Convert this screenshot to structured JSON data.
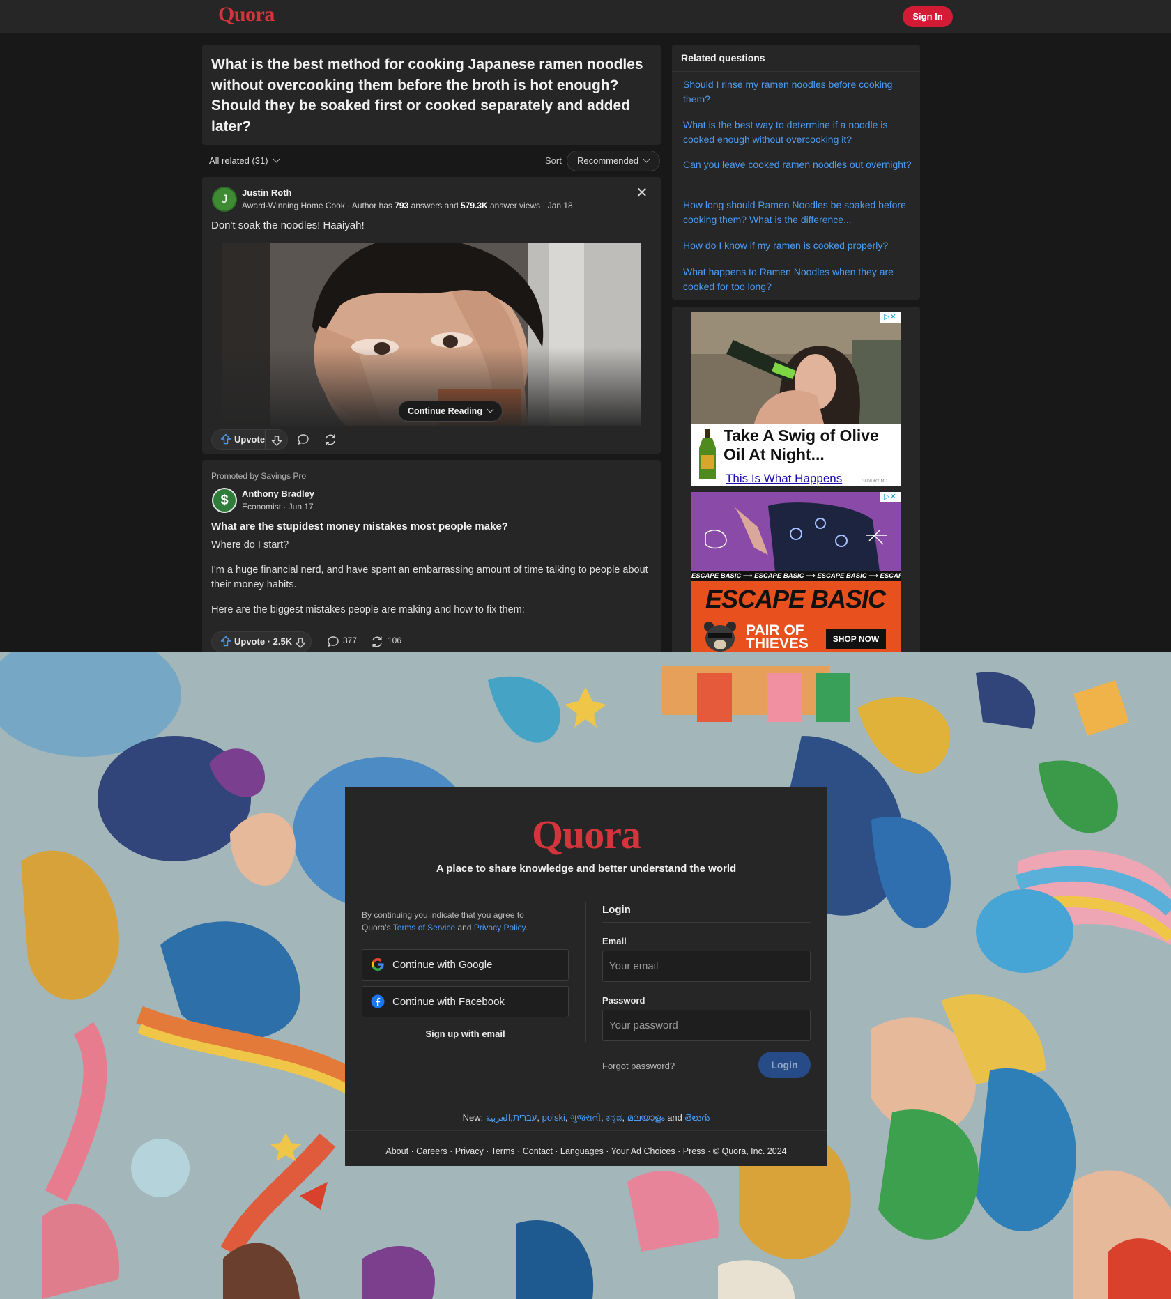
{
  "header": {
    "logo": "Quora",
    "signin_label": "Sign In"
  },
  "question": {
    "title": "What is the best method for cooking Japanese ramen noodles without overcooking them before the broth is hot enough? Should they be soaked first or cooked separately and added later?"
  },
  "filters": {
    "all_related": "All related (31)",
    "sort_label": "Sort",
    "sort_value": "Recommended"
  },
  "answer": {
    "avatar_letter": "J",
    "author": "Justin Roth",
    "meta_prefix": "Award-Winning Home Cook · Author has ",
    "answers_count": "793",
    "meta_mid": " answers and ",
    "views_count": "579.3K",
    "meta_suffix": " answer views · Jan 18",
    "text": "Don't soak the noodles! Haaiyah!",
    "continue_label": "Continue Reading",
    "upvote_label": "Upvote"
  },
  "promo": {
    "promoted_by": "Promoted by Savings Pro",
    "avatar_symbol": "$",
    "author": "Anthony Bradley",
    "meta": "Economist · Jun 17",
    "title": "What are the stupidest money mistakes most people make?",
    "p1": "Where do I start?",
    "p2": "I'm a huge financial nerd, and have spent an embarrassing amount of time talking to people about their money habits.",
    "p3": "Here are the biggest mistakes people are making and how to fix them:",
    "upvote_label": "Upvote · 2.5K",
    "comments": "377",
    "shares": "106"
  },
  "related": {
    "title": "Related questions",
    "items": [
      "Should I rinse my ramen noodles before cooking them?",
      "What is the best way to determine if a noodle is cooked enough without overcooking it?",
      "Can you leave cooked ramen noodles out overnight?",
      "How long should Ramen Noodles be soaked before cooking them? What is the difference...",
      "How do I know if my ramen is cooked properly?",
      "What happens to Ramen Noodles when they are cooked for too long?"
    ]
  },
  "ads": {
    "ad1_title_line1": "Take A Swig of Olive",
    "ad1_title_line2": "Oil At Night...",
    "ad1_link": "This Is What Happens",
    "ad1_brand": "GUNDRY MD",
    "ad2_strip": "ESCAPE BASIC ⟶ ESCAPE BASIC ⟶ ESCAPE BASIC ⟶ ESCAPE BASIC ⟶",
    "ad2_title": "ESCAPE BASIC",
    "ad2_brand_line1": "PAIR OF",
    "ad2_brand_line2": "THIEVES",
    "ad2_cta": "SHOP NOW"
  },
  "login": {
    "logo": "Quora",
    "tagline": "A place to share knowledge and better understand the world",
    "terms_prefix": "By continuing you indicate that you agree to Quora's ",
    "terms_link": "Terms of Service",
    "terms_and": " and ",
    "privacy_link": "Privacy Policy",
    "terms_end": ".",
    "google_label": "Continue with Google",
    "facebook_label": "Continue with Facebook",
    "signup_email": "Sign up with email",
    "login_heading": "Login",
    "email_label": "Email",
    "email_placeholder": "Your email",
    "password_label": "Password",
    "password_placeholder": "Your password",
    "forgot": "Forgot password?",
    "login_button": "Login",
    "new_prefix": "New: ",
    "languages": [
      "עברית",
      "العربية",
      "polski",
      "ગુજરાતી",
      "ಕನ್ನಡ",
      "മലയാളം"
    ],
    "and_word": " and ",
    "last_language": "తెలుగు",
    "footer": "About · Careers · Privacy · Terms · Contact · Languages · Your Ad Choices · Press · © Quora, Inc. 2024"
  },
  "colors": {
    "brand": "#b92b27",
    "link": "#4d9cf3",
    "background": "#181818",
    "card": "#262626"
  }
}
